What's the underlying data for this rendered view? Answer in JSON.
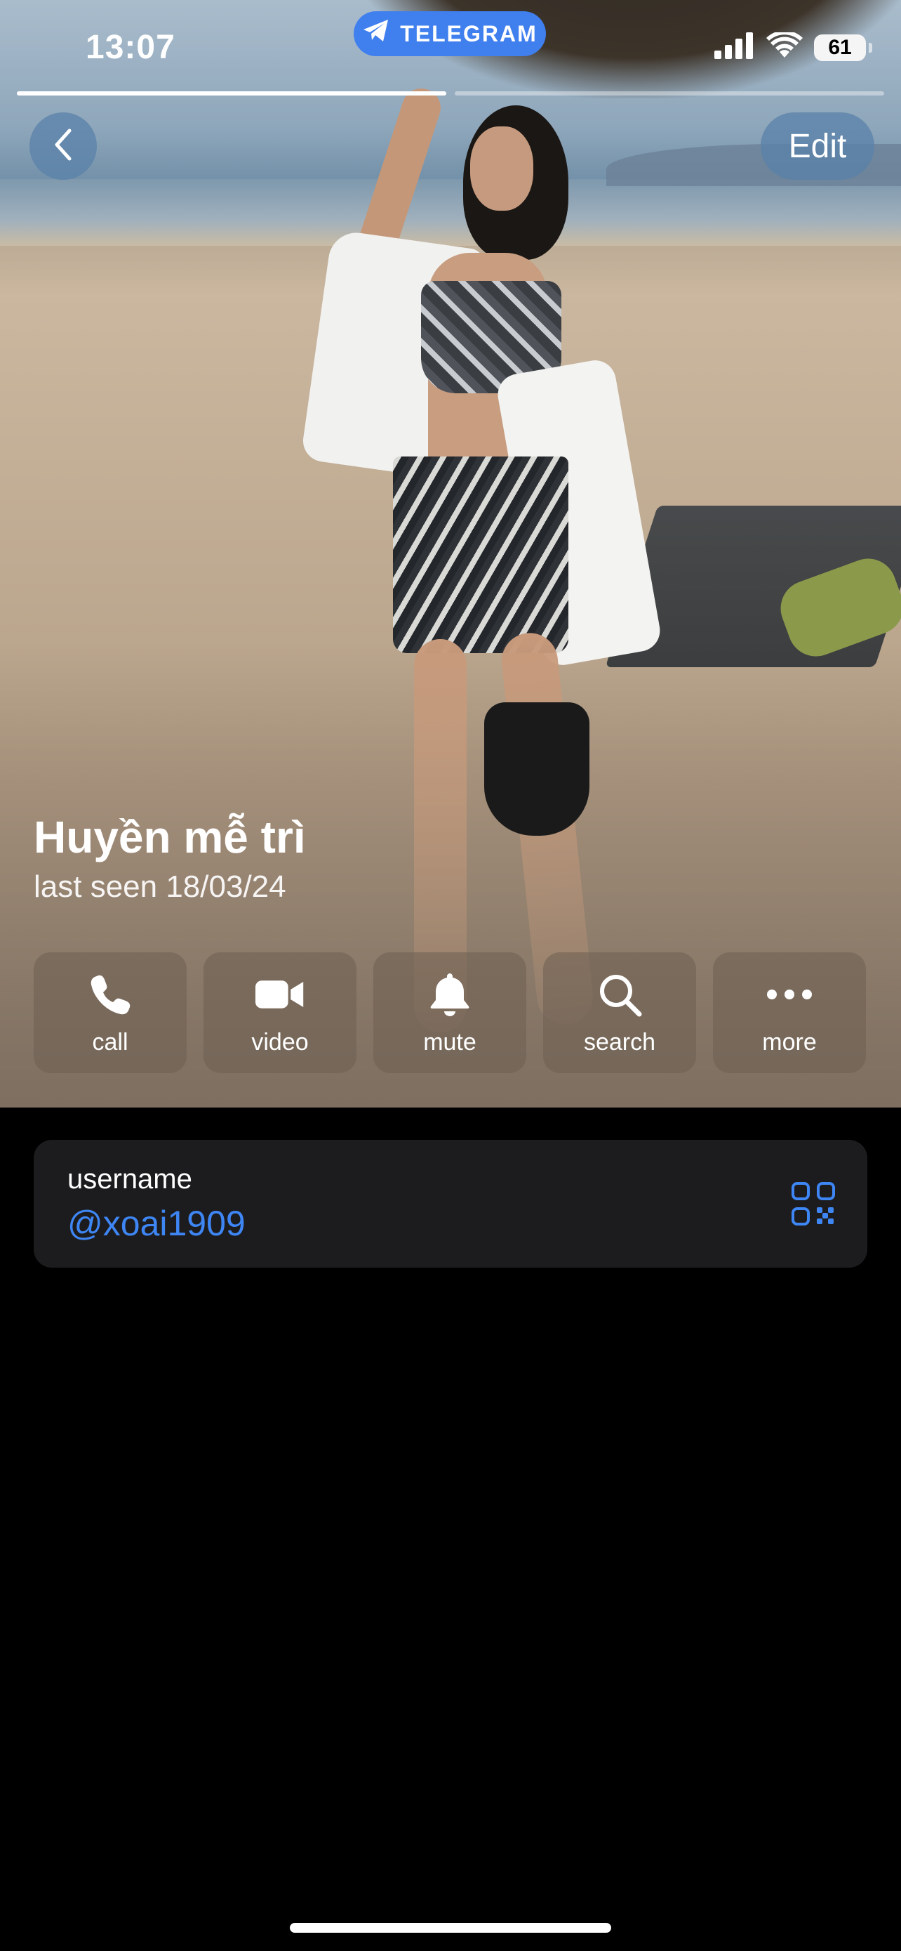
{
  "status_bar": {
    "time": "13:07",
    "app_pill": "TELEGRAM",
    "battery": "61"
  },
  "story_progress": {
    "segments": 2,
    "current": 1,
    "current_fill": 1.0
  },
  "nav": {
    "edit_label": "Edit"
  },
  "profile": {
    "name": "Huyền mễ trì",
    "last_seen": "last seen 18/03/24"
  },
  "actions": [
    {
      "label": "call",
      "icon": "phone-icon"
    },
    {
      "label": "video",
      "icon": "video-camera-icon"
    },
    {
      "label": "mute",
      "icon": "bell-icon"
    },
    {
      "label": "search",
      "icon": "magnifier-icon"
    },
    {
      "label": "more",
      "icon": "ellipsis-icon"
    }
  ],
  "info": {
    "caption": "username",
    "value": "@xoai1909",
    "icon": "qr-code-icon"
  },
  "colors": {
    "accent": "#3e86f4",
    "pill": "#3f7fee",
    "card": "#1c1c1e",
    "background": "#000000"
  }
}
